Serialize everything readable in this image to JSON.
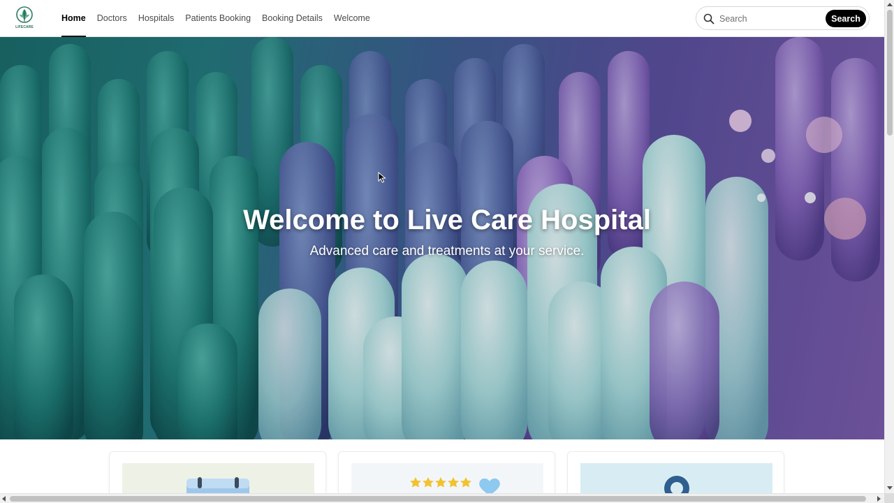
{
  "brand": {
    "logo_text": "LIFECARE"
  },
  "nav": {
    "items": [
      {
        "label": "Home",
        "active": true
      },
      {
        "label": "Doctors"
      },
      {
        "label": "Hospitals"
      },
      {
        "label": "Patients Booking"
      },
      {
        "label": "Booking Details"
      },
      {
        "label": "Welcome"
      }
    ]
  },
  "search": {
    "placeholder": "Search",
    "button_label": "Search"
  },
  "hero": {
    "title": "Welcome to Live Care Hospital",
    "subtitle": "Advanced care and treatments at your service."
  },
  "cards": [
    {
      "icon": "calendar-icon",
      "bg": "#eef2e6"
    },
    {
      "icon": "rating-stars-heart-icon",
      "bg": "#f3f6f9"
    },
    {
      "icon": "location-pin-icon",
      "bg": "#d8edf3"
    }
  ],
  "colors": {
    "accent": "#000000",
    "nav_text": "#4a4a4a",
    "star": "#f2c230",
    "heart": "#8ec9ef"
  }
}
